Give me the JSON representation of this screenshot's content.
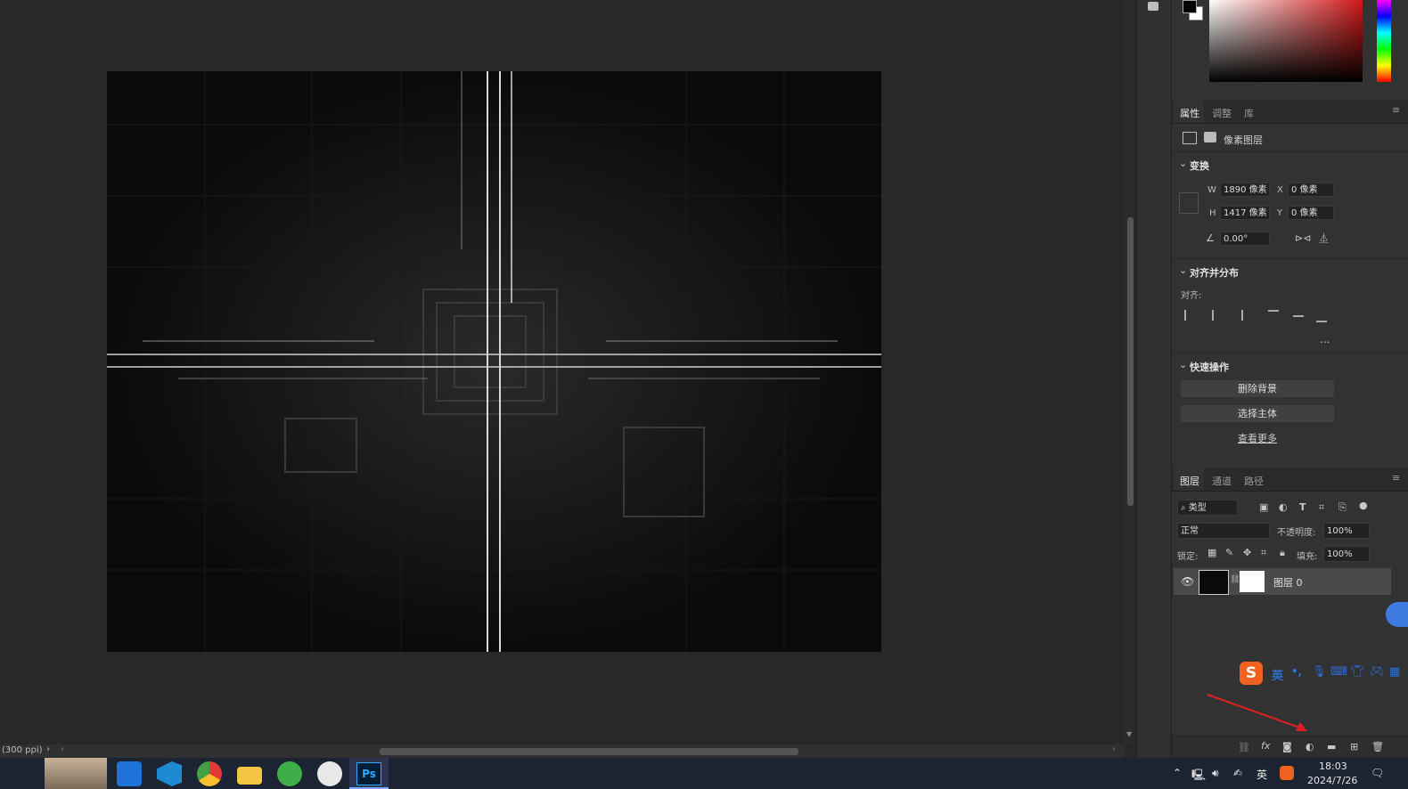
{
  "status": {
    "zoom_text": "(300 ppi)"
  },
  "properties_panel": {
    "tabs": [
      "属性",
      "调整",
      "库"
    ],
    "layer_kind": "像素图层",
    "transform": {
      "title": "变换",
      "w_label": "W",
      "w_value": "1890 像素",
      "h_label": "H",
      "h_value": "1417 像素",
      "x_label": "X",
      "x_value": "0 像素",
      "y_label": "Y",
      "y_value": "0 像素",
      "angle_value": "0.00°"
    },
    "align": {
      "title": "对齐并分布",
      "label": "对齐:",
      "more": "..."
    },
    "quick_actions": {
      "title": "快速操作",
      "remove_bg": "删除背景",
      "select_subject": "选择主体",
      "see_more": "查看更多"
    }
  },
  "layers_panel": {
    "tabs": [
      "图层",
      "通道",
      "路径"
    ],
    "filter_kind": "类型",
    "blend_mode": "正常",
    "opacity_label": "不透明度:",
    "opacity_value": "100%",
    "lock_label": "锁定:",
    "fill_label": "填充:",
    "fill_value": "100%",
    "layers": [
      {
        "name": "图层 0",
        "visible": true
      }
    ]
  },
  "ime_bar": {
    "lang": "英",
    "punct": "•,"
  },
  "taskbar": {
    "apps": [
      "game-app",
      "work-app",
      "vscode",
      "chrome",
      "file-explorer",
      "green-leaf-app",
      "panda-app",
      "photoshop"
    ],
    "ps_label": "Ps",
    "tray_lang": "英",
    "time": "18:03",
    "date": "2024/7/26"
  },
  "colors": {
    "taskbar": "#1c2333",
    "accent_blue": "#3d7be0",
    "sogou_orange": "#f0621f"
  }
}
